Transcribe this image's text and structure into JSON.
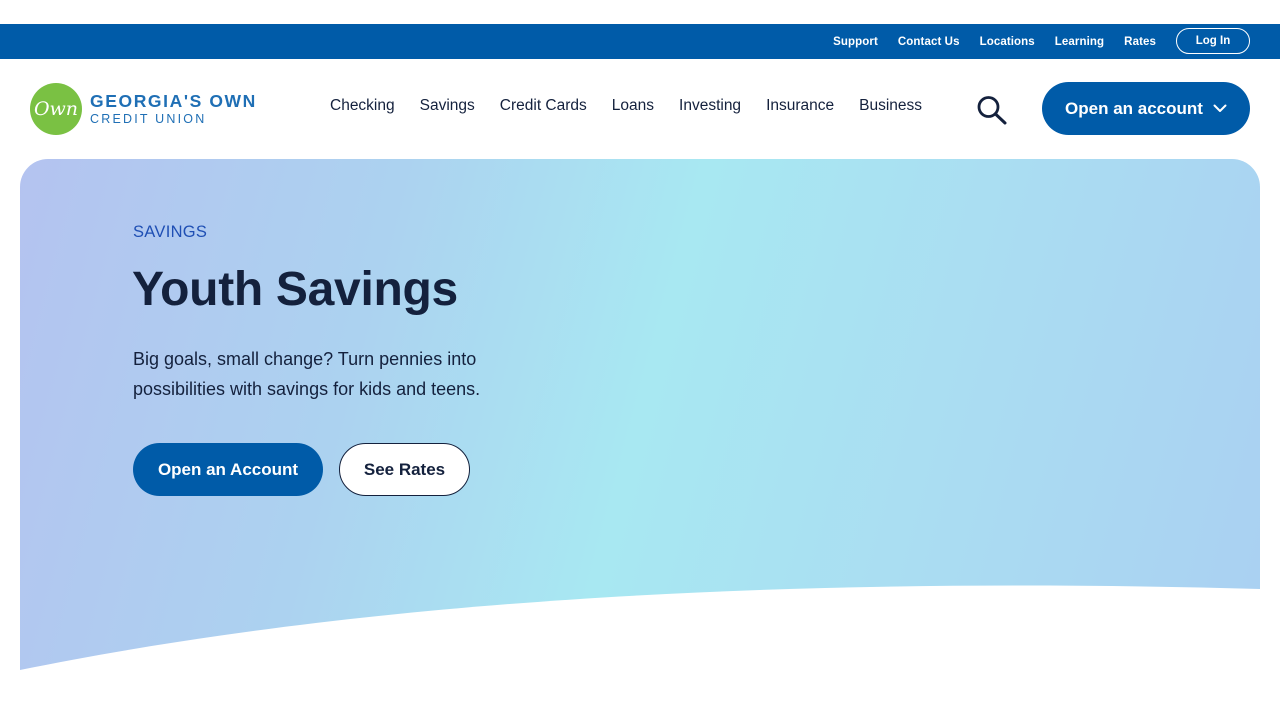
{
  "utility_nav": {
    "links": [
      "Support",
      "Contact Us",
      "Locations",
      "Learning",
      "Rates"
    ],
    "login_label": "Log In"
  },
  "brand": {
    "logo_mark": "Own",
    "name_line1": "GEORGIA'S OWN",
    "name_line2": "CREDIT UNION"
  },
  "main_nav": {
    "items": [
      "Checking",
      "Savings",
      "Credit Cards",
      "Loans",
      "Investing",
      "Insurance",
      "Business"
    ],
    "search_icon": "search-icon",
    "cta_label": "Open an account",
    "cta_icon": "chevron-down-icon"
  },
  "hero": {
    "eyebrow": "SAVINGS",
    "title": "Youth Savings",
    "subtitle": "Big goals, small change? Turn pennies into possibilities with savings for kids and teens.",
    "primary_button": "Open an Account",
    "secondary_button": "See Rates"
  },
  "colors": {
    "brand_blue": "#005ba8",
    "logo_green": "#7ac143",
    "text_dark": "#14213d",
    "eyebrow_blue": "#1f4fb4"
  }
}
